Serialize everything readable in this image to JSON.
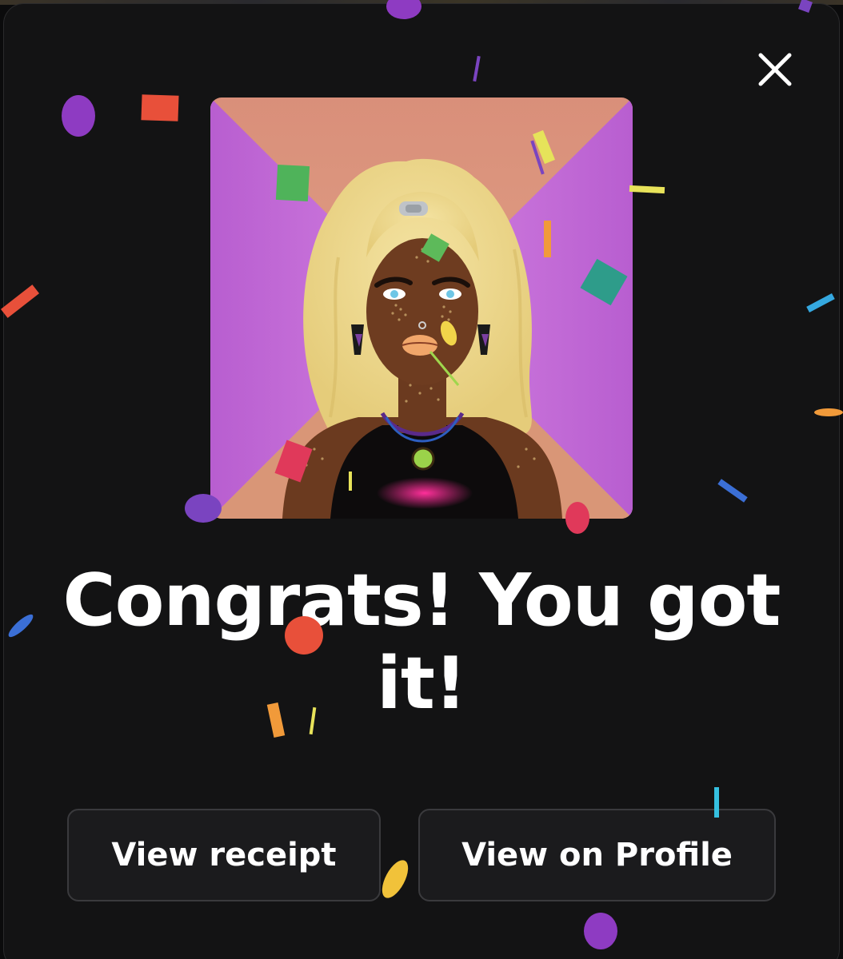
{
  "modal": {
    "headline": "Congrats! You got it!",
    "close_icon": "close-icon",
    "buttons": {
      "view_receipt": "View receipt",
      "view_on_profile": "View on Profile"
    }
  },
  "colors": {
    "background": "#131314",
    "button_background": "#1b1b1d",
    "button_border": "#3a3a3d",
    "text": "#ffffff",
    "art_purple": "#c56ad6",
    "art_peach": "#d98f78",
    "hair_blonde": "#efd98a",
    "skin": "#6b3a1f"
  }
}
